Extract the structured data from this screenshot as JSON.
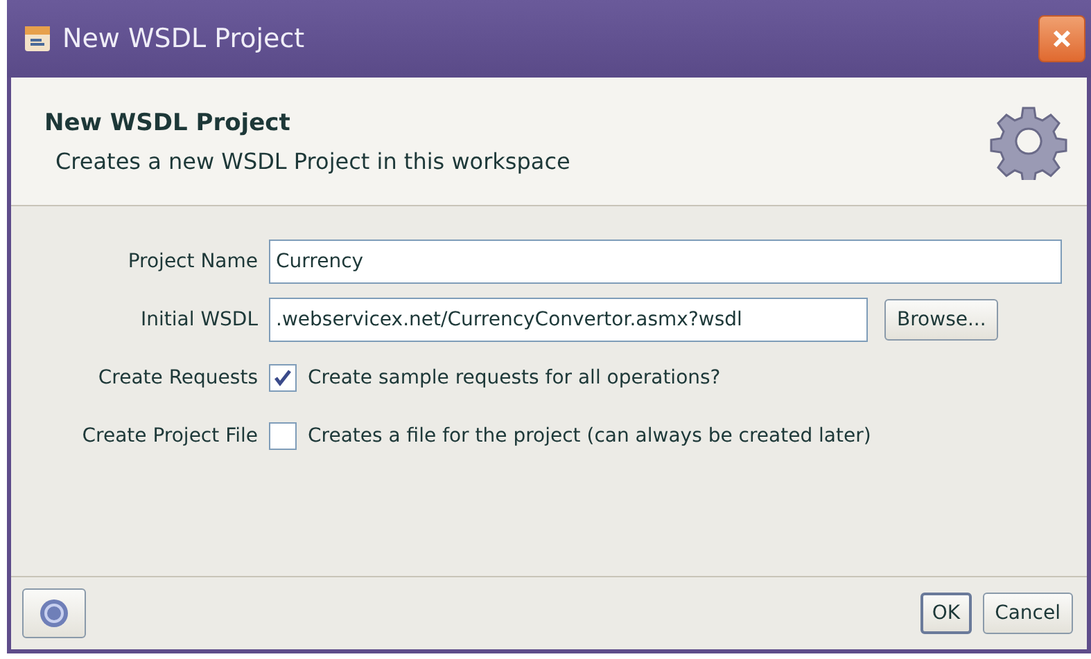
{
  "window": {
    "title": "New WSDL Project"
  },
  "header": {
    "title": "New WSDL Project",
    "description": "Creates a new WSDL Project in this workspace"
  },
  "fields": [
    {
      "kind": "text",
      "label": "Project Name",
      "value": "Currency"
    },
    {
      "kind": "text",
      "label": "Initial WSDL",
      "value": ".webservicex.net/CurrencyConvertor.asmx?wsdl",
      "button": "Browse..."
    },
    {
      "kind": "checkbox",
      "label": "Create Requests",
      "text": "Create sample requests for all operations?",
      "checked": true
    },
    {
      "kind": "checkbox",
      "label": "Create Project File",
      "text": "Creates a file for the project (can always be created later)",
      "checked": false
    }
  ],
  "buttons": [
    "OK",
    "Cancel"
  ]
}
